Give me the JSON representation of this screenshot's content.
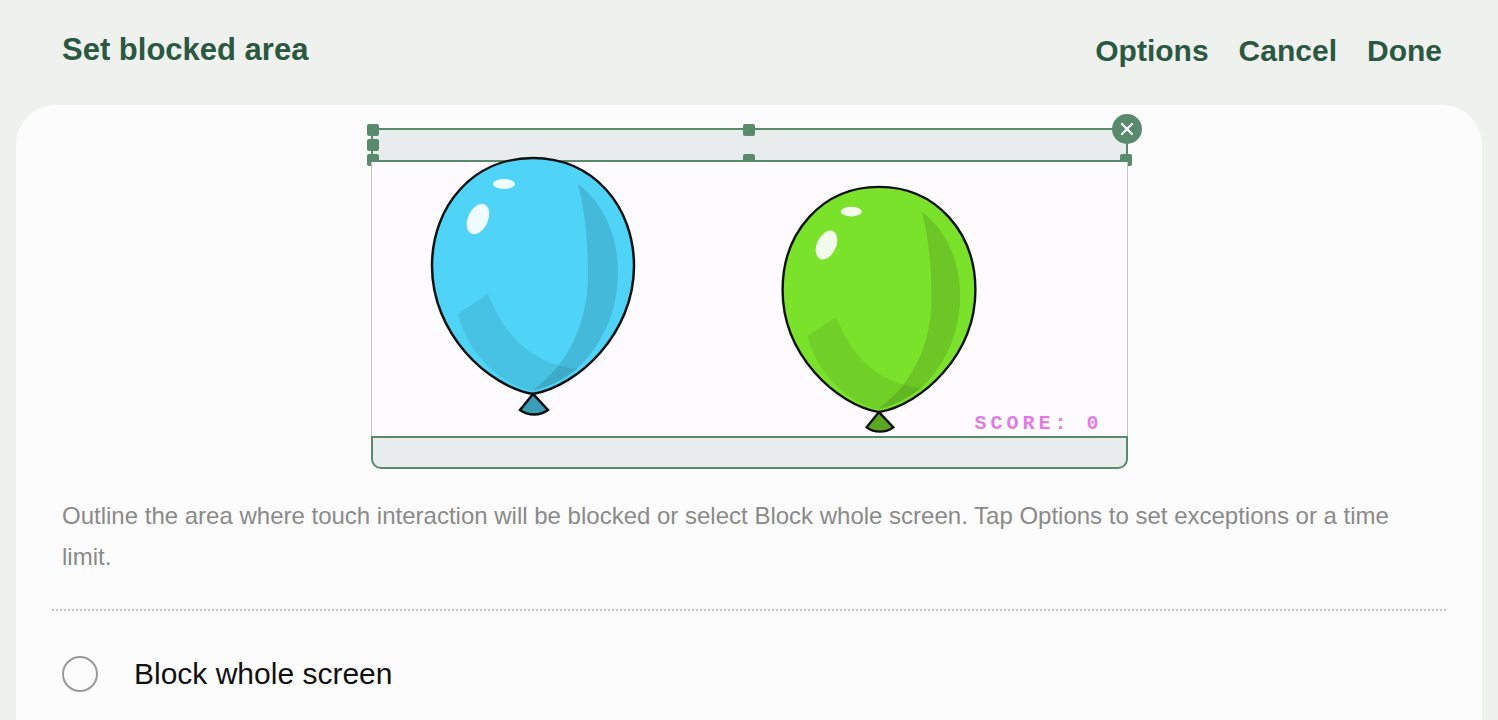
{
  "header": {
    "title": "Set blocked area",
    "actions": [
      {
        "label": "Options"
      },
      {
        "label": "Cancel"
      },
      {
        "label": "Done"
      }
    ]
  },
  "preview": {
    "balloons": [
      {
        "color": "#4fd3f7"
      },
      {
        "color": "#7be22c"
      }
    ],
    "score": "SCORE: 0",
    "blocked_areas": [
      {
        "name": "top",
        "selected": true
      },
      {
        "name": "bottom",
        "selected": false
      }
    ]
  },
  "description": "Outline the area where touch interaction will be blocked or select Block whole screen. Tap Options to set exceptions or a time limit.",
  "options": [
    {
      "label": "Block whole screen",
      "selected": false
    }
  ]
}
